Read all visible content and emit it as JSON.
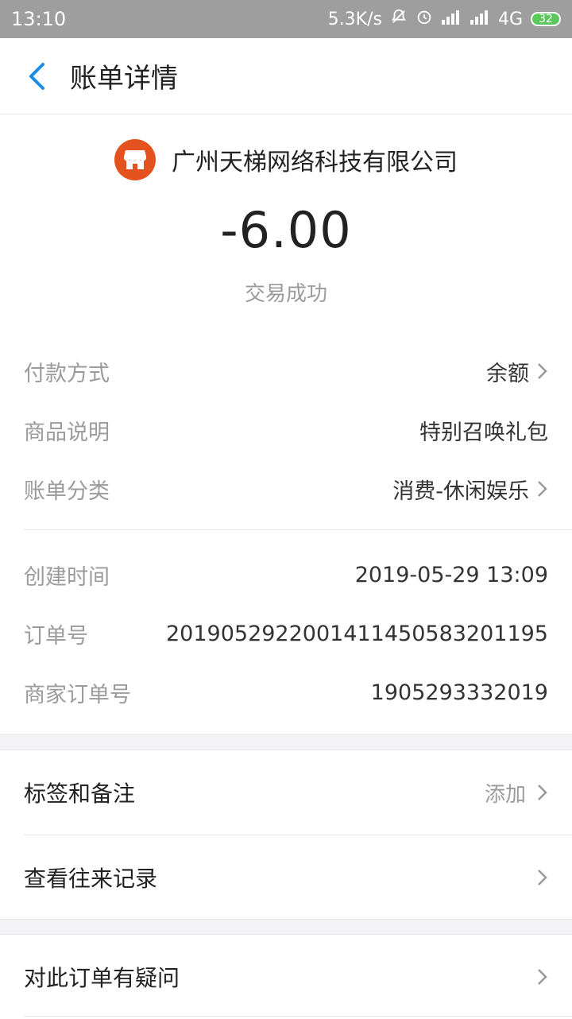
{
  "status_bar": {
    "time": "13:10",
    "net_speed": "5.3K/s",
    "network": "4G",
    "battery": "32"
  },
  "header": {
    "title": "账单详情"
  },
  "summary": {
    "merchant": "广州天梯网络科技有限公司",
    "amount": "-6.00",
    "status": "交易成功"
  },
  "details": {
    "payment_method_label": "付款方式",
    "payment_method_value": "余额",
    "product_label": "商品说明",
    "product_value": "特别召唤礼包",
    "category_label": "账单分类",
    "category_value": "消费-休闲娱乐",
    "created_label": "创建时间",
    "created_value": "2019-05-29 13:09",
    "order_label": "订单号",
    "order_value": "2019052922001411450583201195",
    "merchant_order_label": "商家订单号",
    "merchant_order_value": "1905293332019"
  },
  "actions": {
    "tags_label": "标签和备注",
    "tags_value": "添加",
    "history_label": "查看往来记录",
    "question_label": "对此订单有疑问"
  },
  "colors": {
    "accent": "#1a8ce5",
    "merchant_icon": "#e4531f"
  },
  "icons": {
    "back": "chevron-left-icon",
    "merchant": "shop-icon",
    "row_arrow": "chevron-right-icon"
  }
}
